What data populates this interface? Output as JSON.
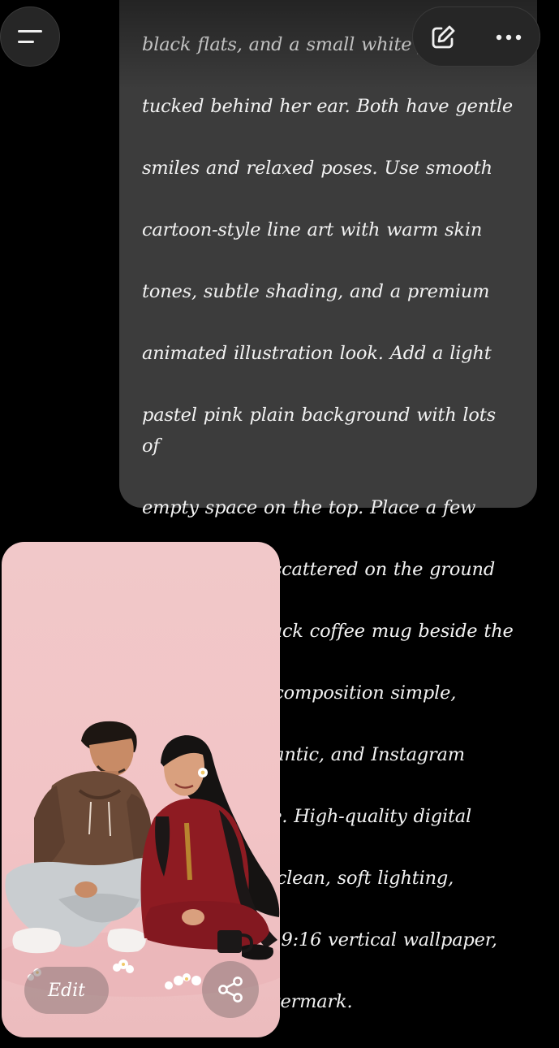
{
  "message": {
    "lines": [
      "black flats, and a small white flower",
      "tucked behind her ear. Both have gentle",
      "smiles and relaxed poses. Use smooth",
      "cartoon-style line art with warm skin",
      "tones, subtle shading, and a premium",
      "animated illustration look. Add a light",
      "pastel pink plain background with lots of",
      "empty space on the top. Place a few",
      "white flowers scattered on the ground",
      "and a small black coffee mug beside the",
      "girl. Keep the composition simple,",
      "aesthetic, romantic, and Instagram",
      "wallpaper style. High-quality digital",
      "artwork, ultra clean, soft lighting,",
      "vibrant colors, 9:16 vertical wallpaper,",
      "no text, no watermark."
    ]
  },
  "toolbar": {
    "menu_icon": "hamburger-menu-icon",
    "compose_icon": "edit-pencil-icon",
    "more_icon": "more-options-icon"
  },
  "image_card": {
    "edit_label": "Edit",
    "share_icon": "share-icon",
    "background_color": "#f2c4c6"
  },
  "colors": {
    "bubble": "#3c3c3c",
    "page": "#000000",
    "button_bg": "#262626"
  }
}
